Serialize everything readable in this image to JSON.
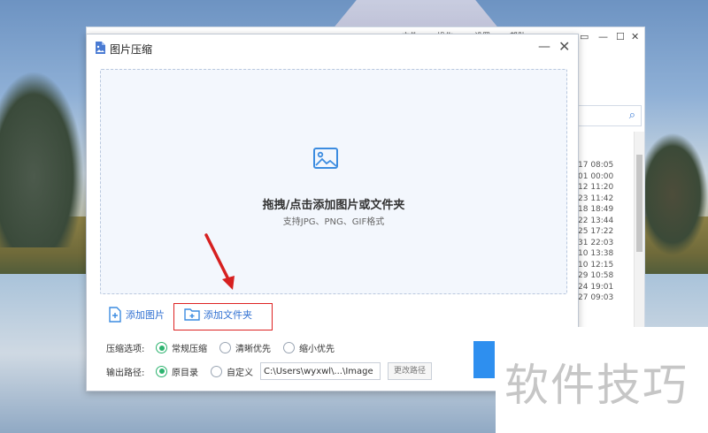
{
  "background_app": {
    "menu": [
      "文件",
      "操作",
      "设置",
      "帮助"
    ],
    "list_times": [
      "17 08:05",
      "01 00:00",
      "12 11:20",
      "23 11:42",
      "18 18:49",
      "22 13:44",
      "25 17:22",
      "31 22:03",
      "10 13:38",
      "10 12:15",
      "29 10:58",
      "24 19:01",
      "27 09:03"
    ]
  },
  "dialog": {
    "title": "图片压缩",
    "dropzone": {
      "title": "拖拽/点击添加图片或文件夹",
      "subtitle": "支持JPG、PNG、GIF格式"
    },
    "add_image_label": "添加图片",
    "add_folder_label": "添加文件夹",
    "compress_options": {
      "label": "压缩选项:",
      "options": [
        "常规压缩",
        "清晰优先",
        "缩小优先"
      ],
      "selected": "常规压缩"
    },
    "output_path": {
      "label": "输出路径:",
      "options": [
        "原目录",
        "自定义"
      ],
      "selected": "原目录",
      "path_value": "C:\\Users\\wyxwl\\...\\Image",
      "change_button": "更改路径"
    }
  },
  "watermark": "软件技巧",
  "colors": {
    "accent": "#2f6fd1",
    "radio_on": "#2db36f",
    "highlight": "#dd2222",
    "start_button": "#2e8fef"
  }
}
